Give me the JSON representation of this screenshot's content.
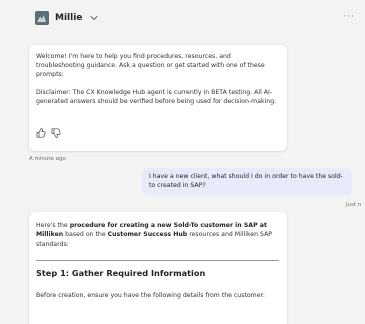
{
  "header": {
    "agent_name": "Millie",
    "more_label": "···"
  },
  "welcome": {
    "message": "Welcome! I'm here to help you find procedures, resources, and troubleshooting guidance. Ask a question or get started with one of these prompts:",
    "disclaimer": "Disclaimer: The CX Knowledge Hub agent is currently in BETA testing. All AI-generated answers should be verified before being used for decision-making.",
    "timestamp": "A minute ago"
  },
  "user_message": {
    "text": "I have a new client, what should I do in order to have the sold-to created in SAP?",
    "timestamp": "Just n"
  },
  "response": {
    "intro_1": "Here's the ",
    "intro_bold_1": "procedure for creating a new Sold-To customer in SAP at Milliken",
    "intro_2": " based on the ",
    "intro_bold_2": "Customer Success Hub",
    "intro_3": " resources and Milliken SAP standards:",
    "step_heading": "Step 1: Gather Required Information",
    "step_body": "Before creation, ensure you have the following details from the customer:"
  }
}
